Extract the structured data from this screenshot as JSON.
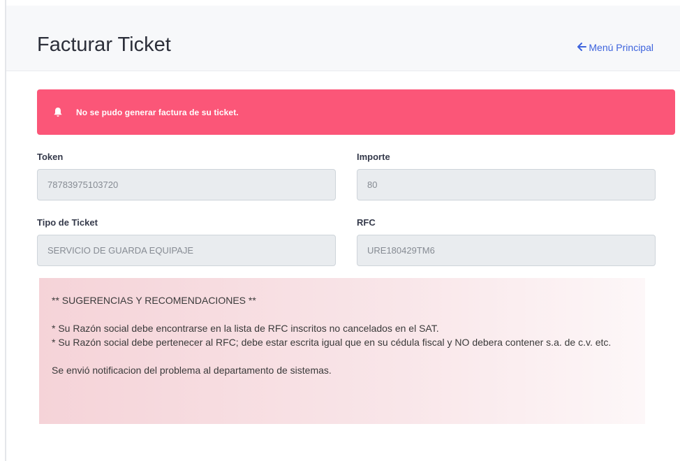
{
  "header": {
    "title": "Facturar Ticket",
    "back_link": "Menú Principal",
    "back_icon": "arrow-left-icon"
  },
  "alert": {
    "icon": "bell-icon",
    "message": "No se pudo generar factura de su ticket.",
    "color": "#fb5678"
  },
  "form": {
    "token": {
      "label": "Token",
      "value": "78783975103720"
    },
    "importe": {
      "label": "Importe",
      "value": "80"
    },
    "tipo_ticket": {
      "label": "Tipo de Ticket",
      "value": "SERVICIO DE GUARDA EQUIPAJE"
    },
    "rfc": {
      "label": "RFC",
      "value": "URE180429TM6"
    }
  },
  "notice": {
    "heading": "** SUGERENCIAS Y RECOMENDACIONES **",
    "line1": "* Su Razón social debe encontrarse en la lista de RFC inscritos no cancelados en el SAT.",
    "line2": "* Su Razón social debe pertenecer al RFC; debe estar escrita igual que en su cédula fiscal y NO debera contener s.a. de c.v. etc.",
    "footer": "Se envió notificacion del problema al departamento de sistemas."
  },
  "colors": {
    "accent_link": "#3d63dd",
    "alert_bg": "#fb5678",
    "title": "#2c2f3a"
  }
}
